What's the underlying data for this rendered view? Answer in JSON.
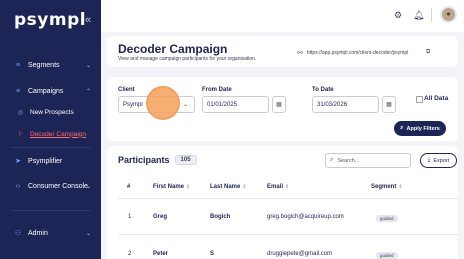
{
  "sidebar": {
    "logo": "psympl",
    "collapse_icon": "«",
    "items": [
      {
        "label": "Segments",
        "icon": "segments-icon"
      },
      {
        "label": "Campaigns",
        "icon": "campaigns-icon"
      },
      {
        "label": "New Prospects",
        "icon": "prospects-icon"
      },
      {
        "label": "Decoder Campaign",
        "icon": "flag-icon"
      },
      {
        "label": "Psymplifier",
        "icon": "psymplifier-icon"
      },
      {
        "label": "Consumer Console",
        "icon": "console-icon"
      },
      {
        "label": "Admin",
        "icon": "admin-icon"
      }
    ],
    "colors": {
      "background": "#1d2456",
      "active": "#ff6b6b"
    }
  },
  "header": {
    "title": "Decoder Campaign",
    "subtitle": "View and manage campaign participants for your organisation.",
    "url": "https://app.psympl.com/client-decoder/psympl"
  },
  "filters": {
    "client_label": "Client",
    "client_value": "Psympl",
    "from_label": "From Date",
    "from_value": "01/01/2025",
    "to_label": "To Date",
    "to_value": "31/03/2026",
    "all_data_label": "All Data",
    "apply_label": "Apply Filters"
  },
  "participants": {
    "title": "Participants",
    "count": "105",
    "search_placeholder": "Search...",
    "export_label": "Export",
    "columns": [
      "#",
      "First Name",
      "Last Name",
      "Email",
      "Segment"
    ],
    "rows": [
      {
        "num": "1",
        "first": "Greg",
        "last": "Bogich",
        "email": "greg.bogich@acquireup.com",
        "segment": "guided"
      },
      {
        "num": "2",
        "first": "Peter",
        "last": "S",
        "email": "druggiepete@gmail.com",
        "segment": "guided"
      }
    ]
  }
}
